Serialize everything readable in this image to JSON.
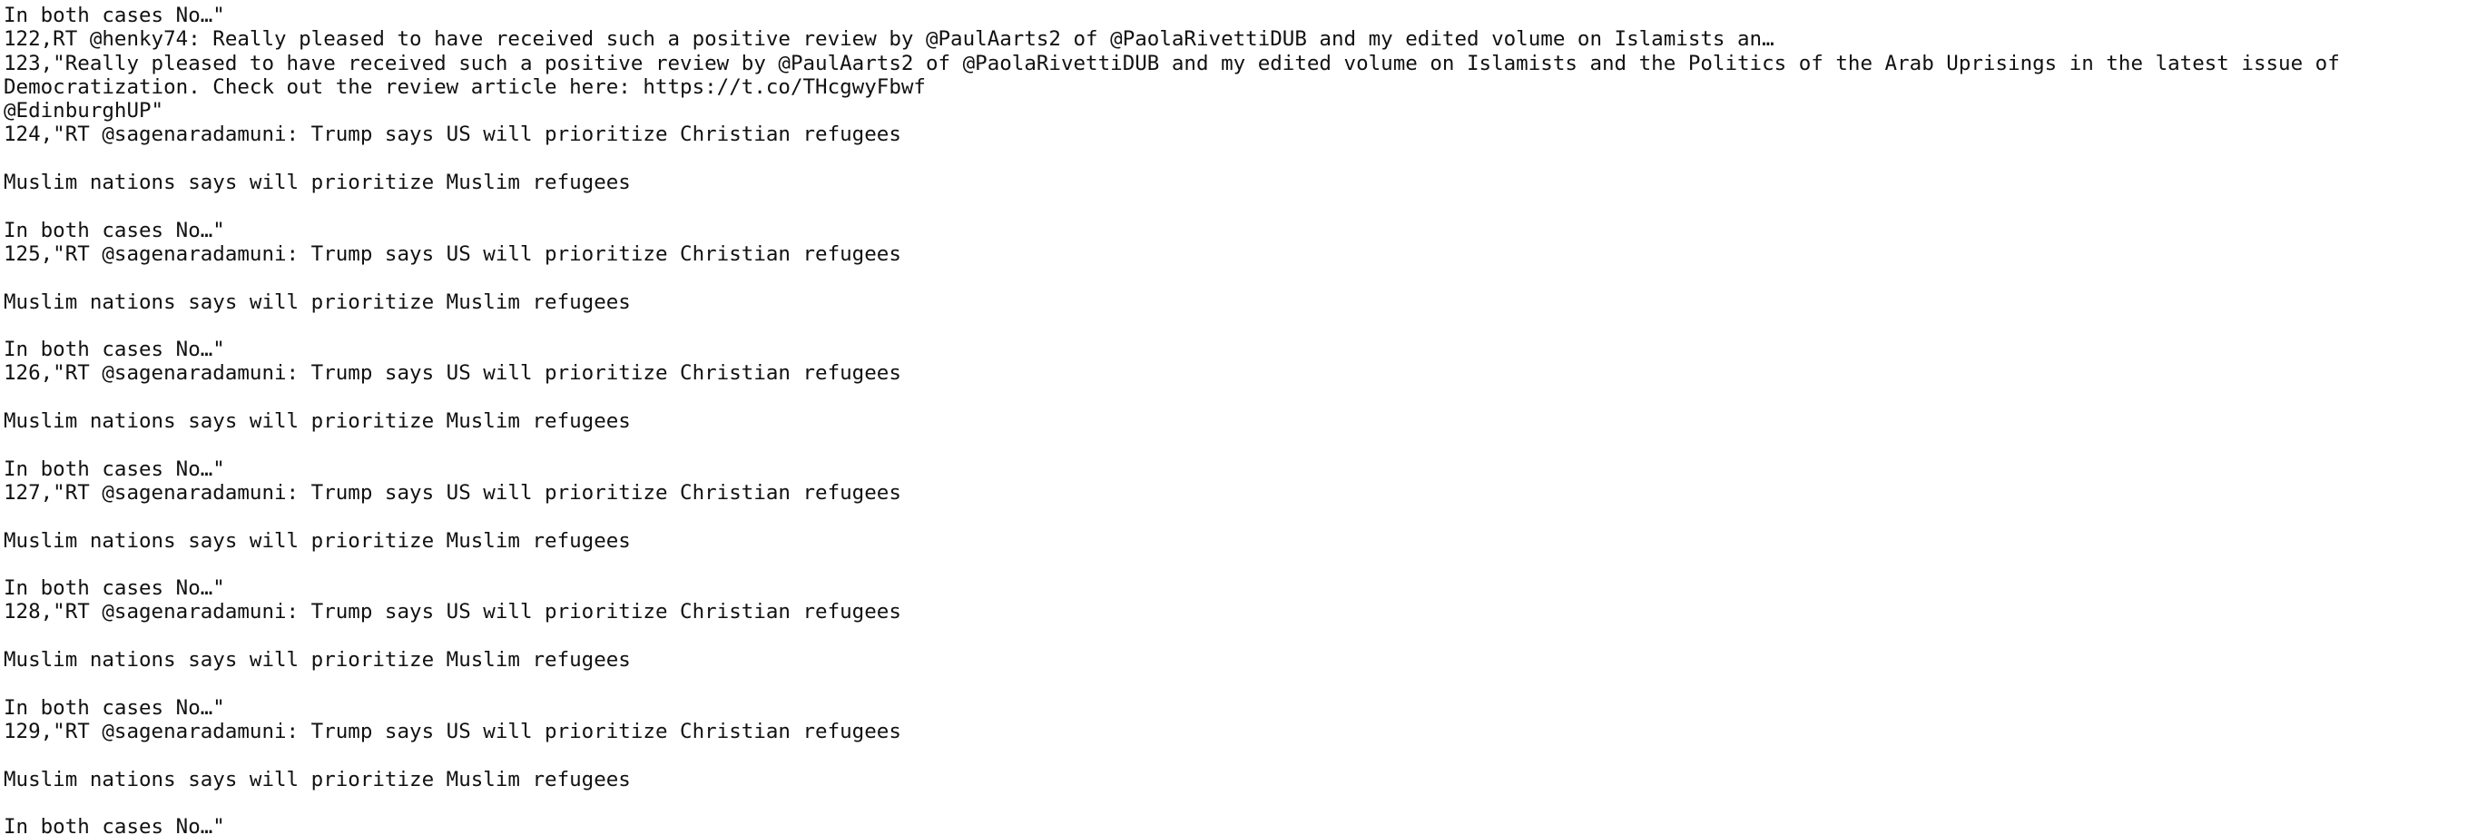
{
  "file_content": {
    "lines": [
      "In both cases No…\"",
      "122,RT @henky74: Really pleased to have received such a positive review by @PaulAarts2 of @PaolaRivettiDUB and my edited volume on Islamists an…",
      "123,\"Really pleased to have received such a positive review by @PaulAarts2 of @PaolaRivettiDUB and my edited volume on Islamists and the Politics of the Arab Uprisings in the latest issue of",
      "Democratization. Check out the review article here: https://t.co/THcgwyFbwf",
      "@EdinburghUP\"",
      "124,\"RT @sagenaradamuni: Trump says US will prioritize Christian refugees",
      "",
      "Muslim nations says will prioritize Muslim refugees",
      "",
      "In both cases No…\"",
      "125,\"RT @sagenaradamuni: Trump says US will prioritize Christian refugees",
      "",
      "Muslim nations says will prioritize Muslim refugees",
      "",
      "In both cases No…\"",
      "126,\"RT @sagenaradamuni: Trump says US will prioritize Christian refugees",
      "",
      "Muslim nations says will prioritize Muslim refugees",
      "",
      "In both cases No…\"",
      "127,\"RT @sagenaradamuni: Trump says US will prioritize Christian refugees",
      "",
      "Muslim nations says will prioritize Muslim refugees",
      "",
      "In both cases No…\"",
      "128,\"RT @sagenaradamuni: Trump says US will prioritize Christian refugees",
      "",
      "Muslim nations says will prioritize Muslim refugees",
      "",
      "In both cases No…\"",
      "129,\"RT @sagenaradamuni: Trump says US will prioritize Christian refugees",
      "",
      "Muslim nations says will prioritize Muslim refugees",
      "",
      "In both cases No…\""
    ]
  }
}
